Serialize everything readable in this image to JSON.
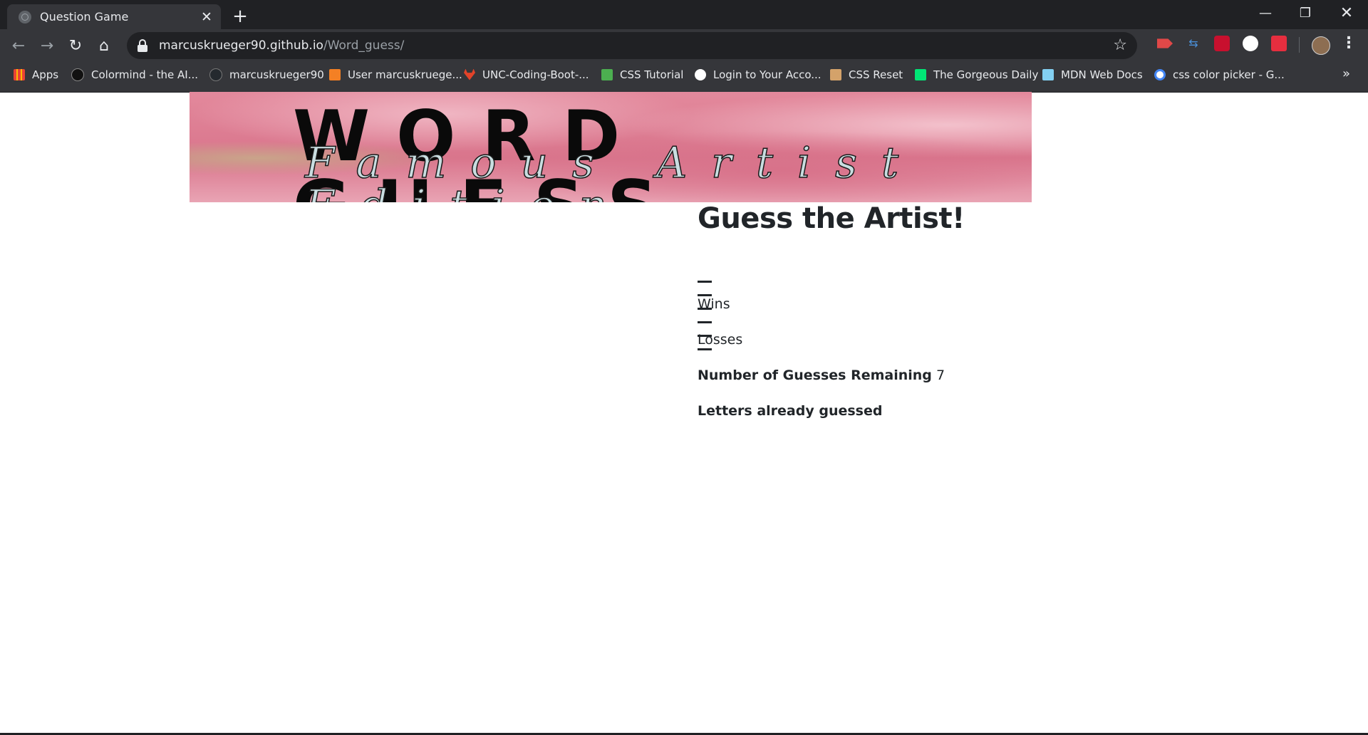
{
  "browser": {
    "tab_title": "Question Game",
    "tab_close": "✕",
    "new_tab": "+",
    "url_host": "marcuskrueger90.github.io",
    "url_path": "/Word_guess/",
    "window_controls": {
      "minimize": "—",
      "maximize": "❐",
      "close": "✕"
    },
    "nav": {
      "back": "←",
      "forward": "→",
      "reload": "↻",
      "home": "⌂",
      "star": "☆",
      "menu": "⋮"
    }
  },
  "bookmarks": [
    {
      "label": "Apps",
      "icon": "apps-grid-icon",
      "color": "#ea4335"
    },
    {
      "label": "Colormind - the AI...",
      "icon": "colormind-icon",
      "color": "#111111"
    },
    {
      "label": "marcuskrueger90",
      "icon": "github-icon",
      "color": "#24292e"
    },
    {
      "label": "User marcuskruege...",
      "icon": "stackoverflow-icon",
      "color": "#f48024"
    },
    {
      "label": "UNC-Coding-Boot-...",
      "icon": "gitlab-icon",
      "color": "#e24329"
    },
    {
      "label": "CSS Tutorial",
      "icon": "w3schools-icon",
      "color": "#4caf50"
    },
    {
      "label": "Login to Your Acco...",
      "icon": "globe-icon",
      "color": "#ffffff"
    },
    {
      "label": "CSS Reset",
      "icon": "css-reset-icon",
      "color": "#d4a26a"
    },
    {
      "label": "The Gorgeous Daily",
      "icon": "gorgeous-daily-icon",
      "color": "#00e676"
    },
    {
      "label": "MDN Web Docs",
      "icon": "mdn-icon",
      "color": "#83d0f2"
    },
    {
      "label": "css color picker - G...",
      "icon": "google-icon",
      "color": "#ffffff"
    }
  ],
  "bookmarks_more": "»",
  "banner": {
    "title": "WORD GUESS",
    "subtitle": "Famous Artist Edition",
    "background_color": "#e07f95"
  },
  "game": {
    "heading": "Guess the Artist!",
    "blank_count": 6,
    "wins_label": "Wins",
    "losses_label": "Losses",
    "guesses_label": "Number of Guesses Remaining",
    "guesses_value": "7",
    "letters_label": "Letters already guessed"
  }
}
